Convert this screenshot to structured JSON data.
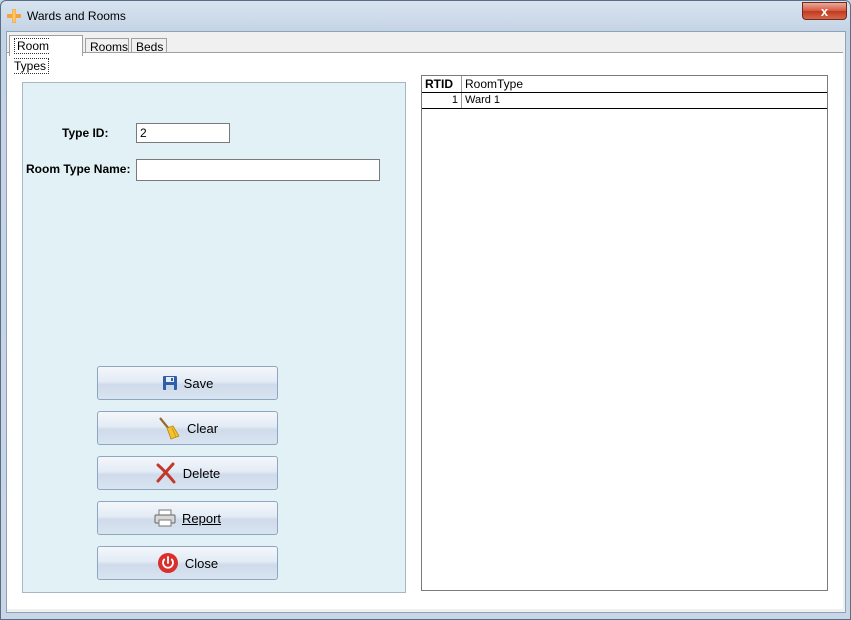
{
  "window": {
    "title": "Wards and Rooms",
    "close_label": "x"
  },
  "tabs": [
    {
      "label": "Room Types"
    },
    {
      "label": "Rooms"
    },
    {
      "label": "Beds"
    }
  ],
  "form": {
    "type_id_label": "Type ID:",
    "type_id_value": "2",
    "room_type_name_label": "Room Type Name:",
    "room_type_name_value": ""
  },
  "buttons": {
    "save": "Save",
    "clear": "Clear",
    "delete": "Delete",
    "report": "Report",
    "close": "Close"
  },
  "grid": {
    "columns": [
      "RTID",
      "RoomType"
    ],
    "rows": [
      [
        "1",
        "Ward 1"
      ]
    ]
  },
  "colors": {
    "panel_bg": "#e2f1f5",
    "button_border": "#8fa6c2",
    "close_red": "#d4573e"
  }
}
